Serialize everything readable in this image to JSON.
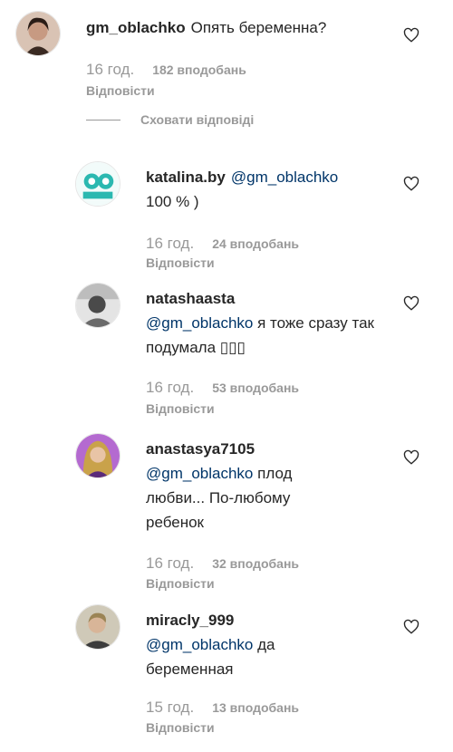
{
  "comments": [
    {
      "username": "gm_oblachko",
      "mention": "",
      "text": "Опять беременна?",
      "time": "16 год.",
      "likes": "182 вподобань",
      "reply_label": "Відповісти",
      "avatar_color": "#6b4b3e"
    }
  ],
  "hide_replies_label": "Сховати відповіді",
  "replies": [
    {
      "username": "katalina.by",
      "mention": "@gm_oblachko",
      "text": "100 % )",
      "time": "16 год.",
      "likes": "24 вподобань",
      "reply_label": "Відповісти",
      "avatar_color": "#2bb8b0"
    },
    {
      "username": "natashaasta",
      "mention": "@gm_oblachko",
      "text": "я тоже сразу так подумала ▯▯▯",
      "time": "16 год.",
      "likes": "53 вподобань",
      "reply_label": "Відповісти",
      "avatar_color": "#777777"
    },
    {
      "username": "anastasya7105",
      "mention": "@gm_oblachko",
      "text": "плод любви... По-любому ребенок",
      "time": "16 год.",
      "likes": "32 вподобань",
      "reply_label": "Відповісти",
      "avatar_color": "#7a3fa0"
    },
    {
      "username": "miracly_999",
      "mention": "@gm_oblachko",
      "text": "да беременная",
      "time": "15 год.",
      "likes": "13 вподобань",
      "reply_label": "Відповісти",
      "avatar_color": "#8a7a5a"
    }
  ]
}
